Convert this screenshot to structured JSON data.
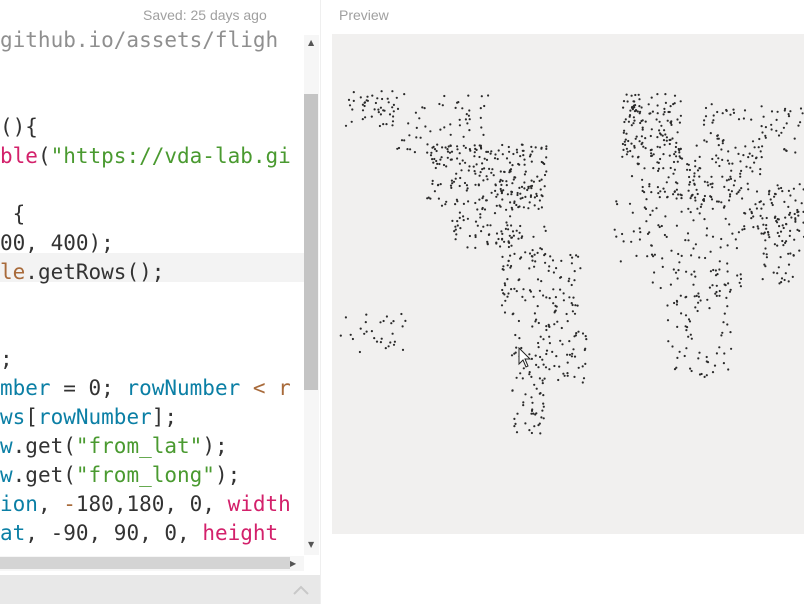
{
  "header": {
    "saved_status": "Saved: 25 days ago",
    "preview_label": "Preview"
  },
  "editor": {
    "lines": [
      {
        "parts": [
          {
            "t": "github.io/assets/fligh",
            "c": "c"
          }
        ]
      },
      {
        "parts": [
          {
            "t": "",
            "c": ""
          }
        ]
      },
      {
        "parts": [
          {
            "t": "",
            "c": ""
          }
        ]
      },
      {
        "parts": [
          {
            "t": "(){",
            "c": ""
          }
        ]
      },
      {
        "parts": [
          {
            "t": "ble",
            "c": "k"
          },
          {
            "t": "(",
            "c": ""
          },
          {
            "t": "\"https://vda-lab.gi",
            "c": "s"
          }
        ]
      },
      {
        "parts": [
          {
            "t": "",
            "c": ""
          }
        ]
      },
      {
        "parts": [
          {
            "t": " {",
            "c": ""
          }
        ]
      },
      {
        "parts": [
          {
            "t": "00, 400);",
            "c": ""
          }
        ]
      },
      {
        "parts": [
          {
            "t": "le",
            "c": "o"
          },
          {
            "t": ".getRows();",
            "c": ""
          }
        ]
      },
      {
        "parts": [
          {
            "t": "",
            "c": ""
          }
        ]
      },
      {
        "parts": [
          {
            "t": "",
            "c": ""
          }
        ]
      },
      {
        "parts": [
          {
            "t": ";",
            "c": ""
          }
        ]
      },
      {
        "parts": [
          {
            "t": "mber",
            "c": "f"
          },
          {
            "t": " = 0; ",
            "c": ""
          },
          {
            "t": "rowNumber",
            "c": "f"
          },
          {
            "t": " < r",
            "c": "o"
          }
        ]
      },
      {
        "parts": [
          {
            "t": "ws",
            "c": "f"
          },
          {
            "t": "[",
            "c": ""
          },
          {
            "t": "rowNumber",
            "c": "f"
          },
          {
            "t": "];",
            "c": ""
          }
        ]
      },
      {
        "parts": [
          {
            "t": "w",
            "c": "f"
          },
          {
            "t": ".get(",
            "c": ""
          },
          {
            "t": "\"from_lat\"",
            "c": "s"
          },
          {
            "t": ");",
            "c": ""
          }
        ]
      },
      {
        "parts": [
          {
            "t": "w",
            "c": "f"
          },
          {
            "t": ".get(",
            "c": ""
          },
          {
            "t": "\"from_long\"",
            "c": "s"
          },
          {
            "t": ");",
            "c": ""
          }
        ]
      },
      {
        "parts": [
          {
            "t": "ion",
            "c": "f"
          },
          {
            "t": ", ",
            "c": ""
          },
          {
            "t": "-",
            "c": "o"
          },
          {
            "t": "180,180, 0, ",
            "c": ""
          },
          {
            "t": "width",
            "c": "k"
          }
        ]
      },
      {
        "parts": [
          {
            "t": "at",
            "c": "f"
          },
          {
            "t": ", -90, 90, 0, ",
            "c": ""
          },
          {
            "t": "height",
            "c": "k"
          }
        ]
      }
    ]
  },
  "preview": {
    "canvas_bg": "#f1f0ef",
    "dot_color": "#2a2a2a",
    "description_free": true
  },
  "colors": {
    "keyword": "#d3216b",
    "variable": "#0b7fa5",
    "string": "#4a9a30"
  }
}
